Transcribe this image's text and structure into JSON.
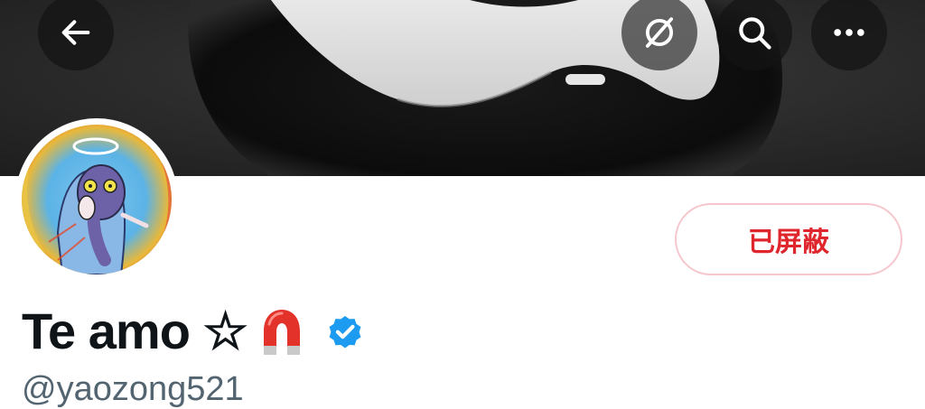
{
  "banner": {
    "description_icon": "banner-image"
  },
  "toolbar": {
    "back_icon": "arrow-left-icon",
    "grok_icon": "slash-circle-icon",
    "search_icon": "search-icon",
    "more_icon": "more-horizontal-icon"
  },
  "profile": {
    "display_name": "Te amo ☆",
    "handle": "@yaozong521",
    "verified_icon": "verified-badge-icon",
    "name_emoji_icon": "magnet-icon",
    "blocked_label": "已屏蔽"
  },
  "colors": {
    "blocked_text": "#e0262d",
    "blocked_border": "#f6c6cc",
    "verified": "#1d9bf0",
    "handle_text": "#536471",
    "name_text": "#0f1419"
  }
}
